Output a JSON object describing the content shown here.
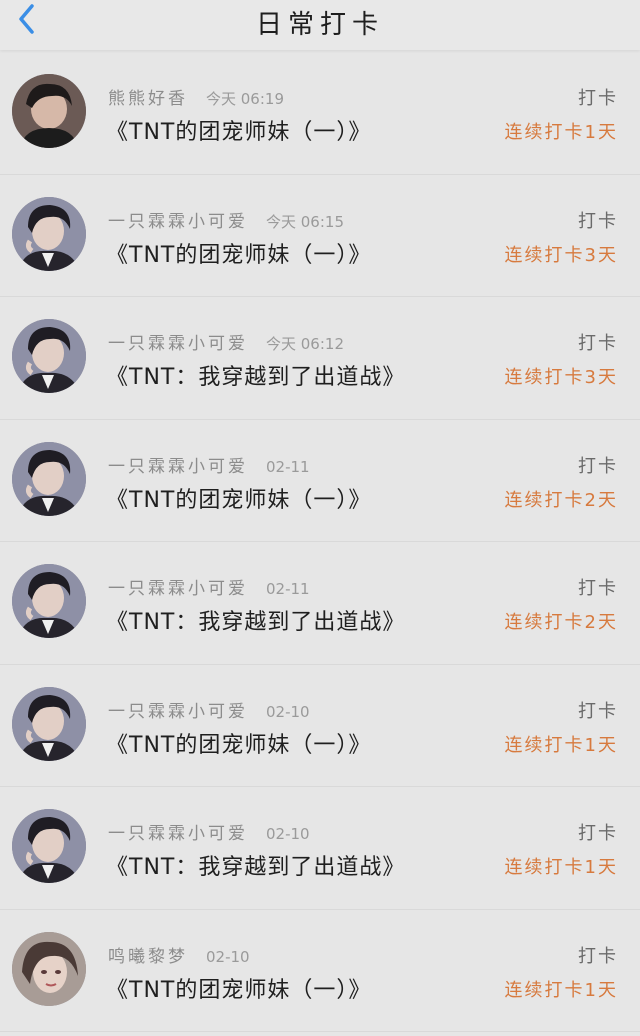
{
  "header": {
    "title": "日常打卡",
    "back_icon": "chevron-left-icon",
    "accent_color": "#3a8ee6"
  },
  "colors": {
    "streak": "#d77a3e"
  },
  "entries": [
    {
      "name": "熊熊好香",
      "time": "今天 06:19",
      "work": "《TNT的团宠师妹（一）》",
      "tag": "打卡",
      "streak": "连续打卡1天",
      "avatar": "avatar-dark-hair"
    },
    {
      "name": "一只霖霖小可爱",
      "time": "今天 06:15",
      "work": "《TNT的团宠师妹（一）》",
      "tag": "打卡",
      "streak": "连续打卡3天",
      "avatar": "avatar-suit"
    },
    {
      "name": "一只霖霖小可爱",
      "time": "今天 06:12",
      "work": "《TNT：我穿越到了出道战》",
      "tag": "打卡",
      "streak": "连续打卡3天",
      "avatar": "avatar-suit"
    },
    {
      "name": "一只霖霖小可爱",
      "time": "02-11",
      "work": "《TNT的团宠师妹（一）》",
      "tag": "打卡",
      "streak": "连续打卡2天",
      "avatar": "avatar-suit"
    },
    {
      "name": "一只霖霖小可爱",
      "time": "02-11",
      "work": "《TNT：我穿越到了出道战》",
      "tag": "打卡",
      "streak": "连续打卡2天",
      "avatar": "avatar-suit"
    },
    {
      "name": "一只霖霖小可爱",
      "time": "02-10",
      "work": "《TNT的团宠师妹（一）》",
      "tag": "打卡",
      "streak": "连续打卡1天",
      "avatar": "avatar-suit"
    },
    {
      "name": "一只霖霖小可爱",
      "time": "02-10",
      "work": "《TNT：我穿越到了出道战》",
      "tag": "打卡",
      "streak": "连续打卡1天",
      "avatar": "avatar-suit"
    },
    {
      "name": "鸣曦黎梦",
      "time": "02-10",
      "work": "《TNT的团宠师妹（一）》",
      "tag": "打卡",
      "streak": "连续打卡1天",
      "avatar": "avatar-illustration"
    }
  ]
}
